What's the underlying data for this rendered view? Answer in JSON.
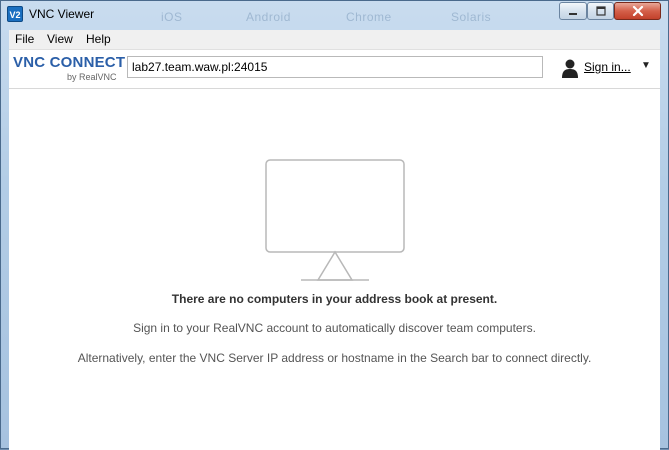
{
  "window": {
    "title": "VNC Viewer",
    "app_icon_text": "V2",
    "background_tabs": [
      "iOS",
      "Android",
      "Chrome",
      "Solaris"
    ]
  },
  "menu": {
    "items": [
      {
        "label": "File"
      },
      {
        "label": "View"
      },
      {
        "label": "Help"
      }
    ]
  },
  "toolbar": {
    "logo_main": "VNC CONNECT",
    "logo_sub": "by RealVNC",
    "address_value": "lab27.team.waw.pl:24015",
    "signin_label": "Sign in..."
  },
  "content": {
    "empty_title": "There are no computers in your address book at present.",
    "line1": "Sign in to your RealVNC account to automatically discover team computers.",
    "line2": "Alternatively, enter the VNC Server IP address or hostname in the Search bar to connect directly."
  },
  "icons": {
    "app": "vnc-app-icon",
    "minimize": "minimize-icon",
    "maximize": "maximize-icon",
    "close": "close-icon",
    "person": "person-icon",
    "dropdown": "chevron-down-icon",
    "monitor": "monitor-icon"
  },
  "colors": {
    "accent": "#2b5fa8",
    "close_button": "#c2412b",
    "titlebar": "#b3cde6"
  }
}
